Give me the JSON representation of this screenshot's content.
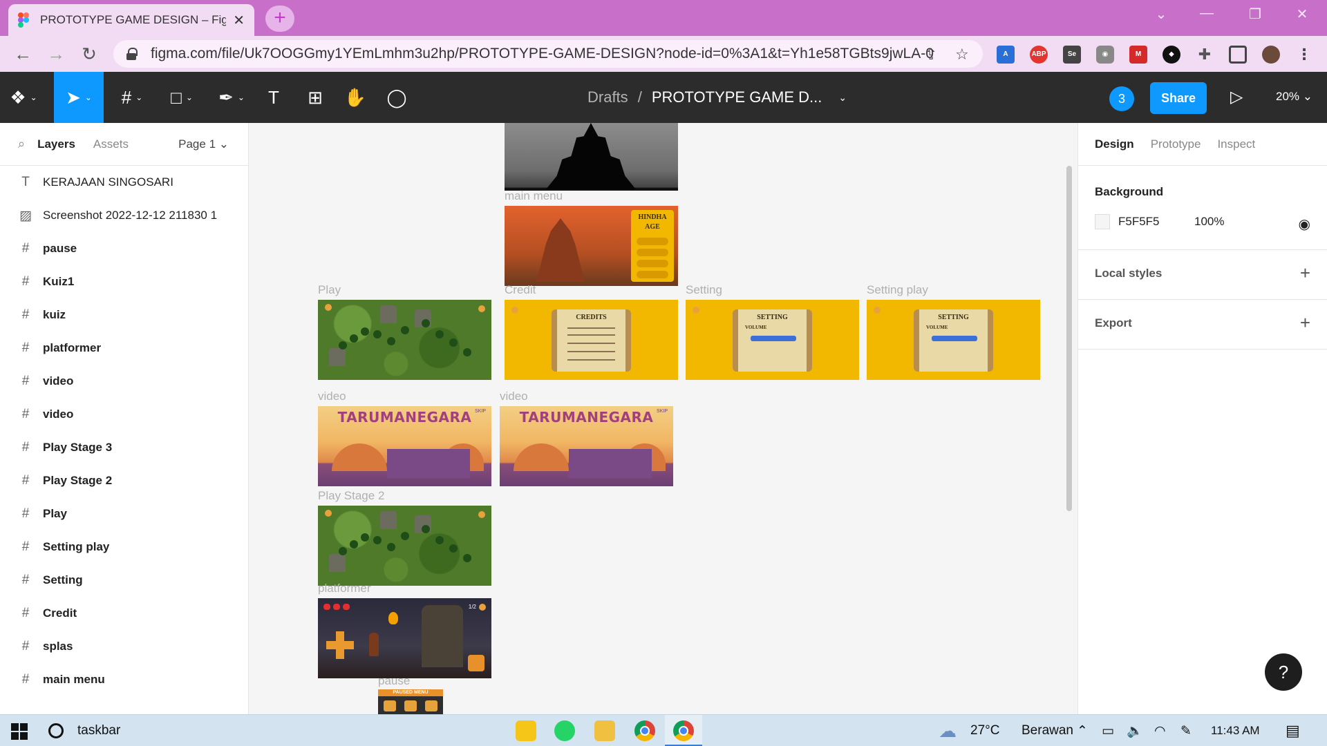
{
  "browser": {
    "tab_title": "PROTOTYPE GAME DESIGN – Figma",
    "url": "figma.com/file/Uk7OOGGmy1YEmLmhm3u2hp/PROTOTYPE-GAME-DESIGN?node-id=0%3A1&t=Yh1e58TGBts9jwLA-0",
    "extensions": [
      "translate-icon",
      "abp-icon",
      "se-icon",
      "camera-icon",
      "red-extension-icon",
      "location-icon",
      "puzzle-icon",
      "sidepanel-icon",
      "profile-avatar"
    ]
  },
  "figma_toolbar": {
    "breadcrumb_drafts": "Drafts",
    "breadcrumb_sep": "/",
    "file_name": "PROTOTYPE GAME D...",
    "user_count": "3",
    "share_label": "Share",
    "zoom": "20%"
  },
  "left_panel": {
    "tab_layers": "Layers",
    "tab_assets": "Assets",
    "page": "Page 1",
    "layers": [
      {
        "type": "text",
        "name": "KERAJAAN SINGOSARI"
      },
      {
        "type": "image",
        "name": "Screenshot 2022-12-12 211830 1"
      },
      {
        "type": "frame",
        "name": "pause"
      },
      {
        "type": "frame",
        "name": "Kuiz1"
      },
      {
        "type": "frame",
        "name": "kuiz"
      },
      {
        "type": "frame",
        "name": "platformer"
      },
      {
        "type": "frame",
        "name": "video"
      },
      {
        "type": "frame",
        "name": "video"
      },
      {
        "type": "frame",
        "name": "Play Stage 3"
      },
      {
        "type": "frame",
        "name": "Play Stage 2"
      },
      {
        "type": "frame",
        "name": "Play"
      },
      {
        "type": "frame",
        "name": "Setting play"
      },
      {
        "type": "frame",
        "name": "Setting"
      },
      {
        "type": "frame",
        "name": "Credit"
      },
      {
        "type": "frame",
        "name": "splas"
      },
      {
        "type": "frame",
        "name": "main menu"
      }
    ]
  },
  "canvas": {
    "labels": {
      "main_menu": "main menu",
      "play": "Play",
      "credit": "Credit",
      "setting": "Setting",
      "setting_play": "Setting play",
      "video1": "video",
      "video2": "video",
      "play_stage_2": "Play Stage 2",
      "platformer": "platformer",
      "pause": "pause"
    },
    "frame_text": {
      "hindha_age": "HINDHA AGE",
      "credits": "CREDITS",
      "setting": "SETTING",
      "volume": "VOLUME",
      "tarumanegara": "TARUMANEGARA",
      "skip": "SKIP",
      "paused_menu": "PAUSED MENU",
      "score": "1/2"
    }
  },
  "right_panel": {
    "tab_design": "Design",
    "tab_prototype": "Prototype",
    "tab_inspect": "Inspect",
    "background_title": "Background",
    "bg_hex": "F5F5F5",
    "bg_opacity": "100%",
    "local_styles": "Local styles",
    "export": "Export",
    "help": "?"
  },
  "taskbar": {
    "search_text": "taskbar",
    "weather_temp": "27°C",
    "weather_desc": "Berawan",
    "time": "11:43 AM"
  },
  "colors": {
    "figma_blue": "#0d99ff",
    "toolbar_bg": "#2c2c2c",
    "browser_accent": "#c86fca"
  }
}
